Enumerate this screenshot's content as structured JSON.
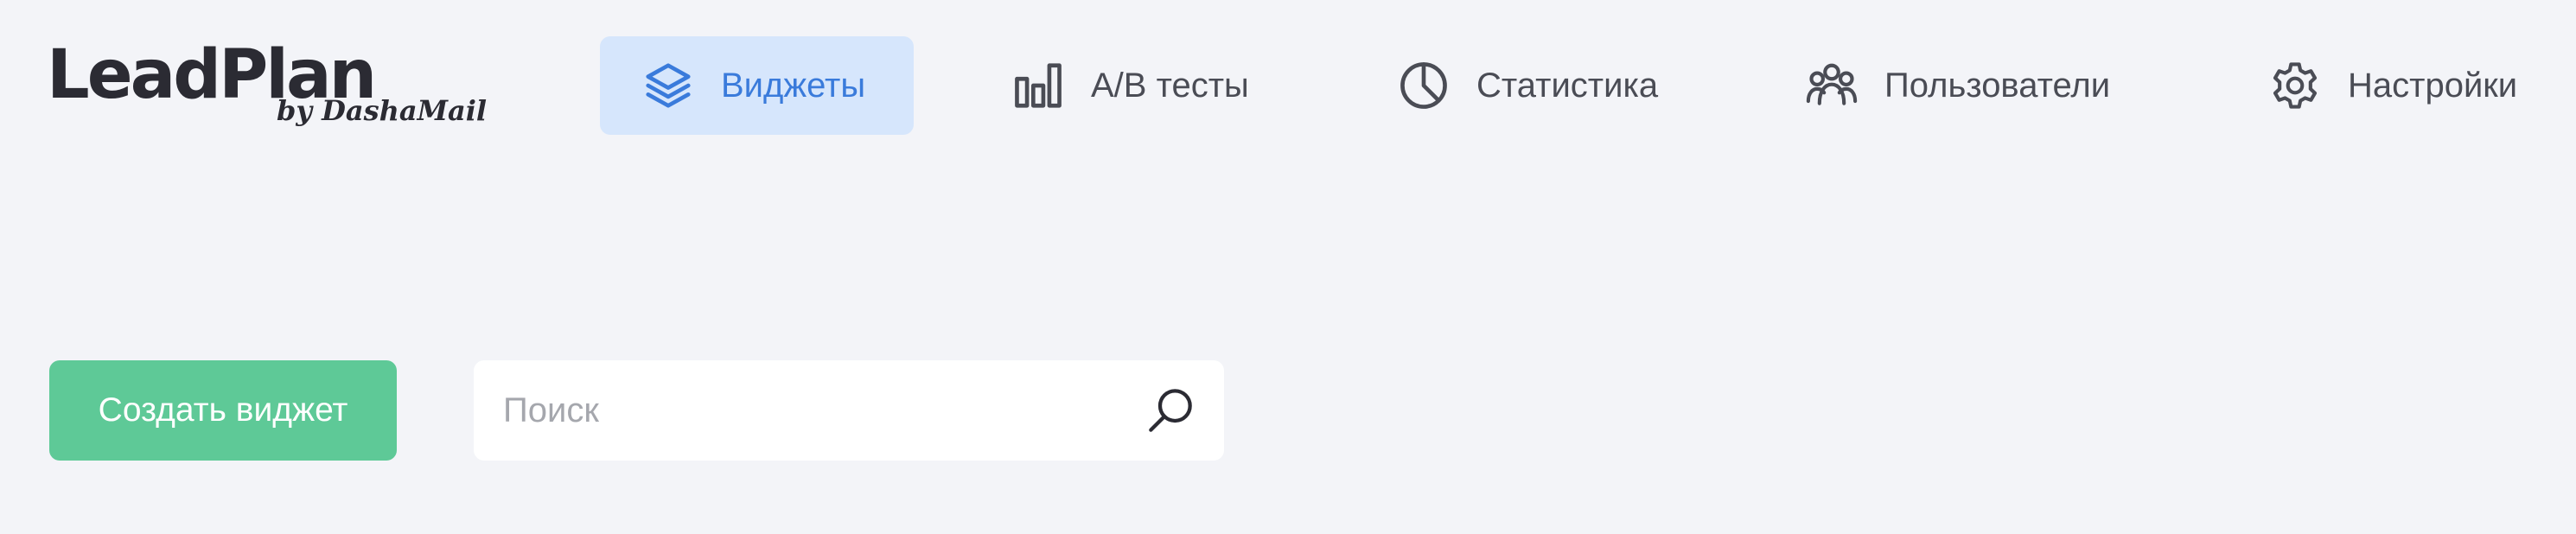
{
  "brand": {
    "name": "LeadPlan",
    "byline": "by DashaMail"
  },
  "nav": {
    "items": [
      {
        "label": "Виджеты",
        "icon": "layers-icon",
        "active": true
      },
      {
        "label": "A/B тесты",
        "icon": "bar-chart-icon",
        "active": false
      },
      {
        "label": "Статистика",
        "icon": "pie-chart-icon",
        "active": false
      },
      {
        "label": "Пользователи",
        "icon": "users-icon",
        "active": false
      },
      {
        "label": "Настройки",
        "icon": "gear-icon",
        "active": false
      }
    ]
  },
  "toolbar": {
    "create_label": "Создать виджет",
    "search": {
      "placeholder": "Поиск",
      "value": "",
      "icon": "search-icon"
    }
  },
  "colors": {
    "background": "#f3f4f8",
    "active_tab_bg": "#d6e6fc",
    "active_tab_text": "#3a7bdb",
    "primary_button": "#5ec997",
    "nav_text": "#4a4c55"
  }
}
